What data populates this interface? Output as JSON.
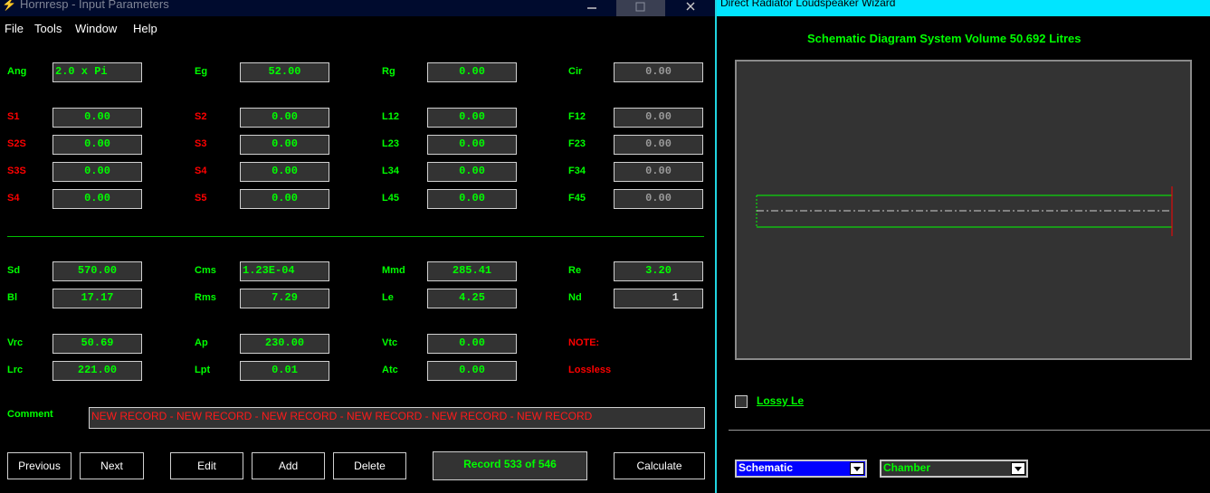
{
  "left_window": {
    "title": "Hornresp - Input Parameters",
    "minimize_icon": "minimize-icon",
    "maximize_icon": "maximize-icon",
    "close_icon": "close-icon",
    "menu": [
      "File",
      "Tools",
      "Window",
      "Help"
    ],
    "rows": [
      [
        {
          "label": "Ang",
          "color": "g",
          "value": "2.0 x Pi",
          "align": "left"
        },
        {
          "label": "Eg",
          "color": "g",
          "value": "52.00"
        },
        {
          "label": "Rg",
          "color": "g",
          "value": "0.00"
        },
        {
          "label": "Cir",
          "color": "g",
          "value": "0.00",
          "dim": true
        }
      ],
      [
        {
          "label": "S1",
          "color": "r",
          "value": "0.00"
        },
        {
          "label": "S2",
          "color": "r",
          "value": "0.00"
        },
        {
          "label": "L12",
          "color": "g",
          "value": "0.00"
        },
        {
          "label": "F12",
          "color": "g",
          "value": "0.00",
          "dim": true
        }
      ],
      [
        {
          "label": "S2S",
          "color": "r",
          "value": "0.00"
        },
        {
          "label": "S3",
          "color": "r",
          "value": "0.00"
        },
        {
          "label": "L23",
          "color": "g",
          "value": "0.00"
        },
        {
          "label": "F23",
          "color": "g",
          "value": "0.00",
          "dim": true
        }
      ],
      [
        {
          "label": "S3S",
          "color": "r",
          "value": "0.00"
        },
        {
          "label": "S4",
          "color": "r",
          "value": "0.00"
        },
        {
          "label": "L34",
          "color": "g",
          "value": "0.00"
        },
        {
          "label": "F34",
          "color": "g",
          "value": "0.00",
          "dim": true
        }
      ],
      [
        {
          "label": "S4",
          "color": "r",
          "value": "0.00"
        },
        {
          "label": "S5",
          "color": "r",
          "value": "0.00"
        },
        {
          "label": "L45",
          "color": "g",
          "value": "0.00"
        },
        {
          "label": "F45",
          "color": "g",
          "value": "0.00",
          "dim": true
        }
      ],
      [
        {
          "label": "Sd",
          "color": "g",
          "value": "570.00"
        },
        {
          "label": "Cms",
          "color": "g",
          "value": "1.23E-04",
          "align": "left"
        },
        {
          "label": "Mmd",
          "color": "g",
          "value": "285.41"
        },
        {
          "label": "Re",
          "color": "g",
          "value": "3.20"
        }
      ],
      [
        {
          "label": "Bl",
          "color": "g",
          "value": "17.17"
        },
        {
          "label": "Rms",
          "color": "g",
          "value": "7.29"
        },
        {
          "label": "Le",
          "color": "g",
          "value": "4.25"
        },
        {
          "label": "Nd",
          "color": "g",
          "value": "1",
          "align": "right"
        }
      ],
      [
        {
          "label": "Vrc",
          "color": "g",
          "value": "50.69"
        },
        {
          "label": "Ap",
          "color": "g",
          "value": "230.00"
        },
        {
          "label": "Vtc",
          "color": "g",
          "value": "0.00"
        },
        {
          "label": "NOTE:",
          "color": "r",
          "value": null
        }
      ],
      [
        {
          "label": "Lrc",
          "color": "g",
          "value": "221.00"
        },
        {
          "label": "Lpt",
          "color": "g",
          "value": "0.01"
        },
        {
          "label": "Atc",
          "color": "g",
          "value": "0.00"
        },
        {
          "label": "Lossless",
          "color": "r",
          "value": null
        }
      ]
    ],
    "comment_label": "Comment",
    "comment_value": "NEW RECORD - NEW RECORD - NEW RECORD - NEW RECORD - NEW RECORD - NEW RECORD",
    "buttons": {
      "previous": "Previous",
      "next": "Next",
      "edit": "Edit",
      "add": "Add",
      "delete": "Delete",
      "calculate": "Calculate"
    },
    "record_status": "Record 533 of 546"
  },
  "right_window": {
    "title": "Direct Radiator Loudspeaker Wizard",
    "schematic_title": "Schematic Diagram   System Volume 50.692 Litres",
    "lossy_le_label": "Lossy Le",
    "lossy_le_checked": false,
    "dropdown_view": "Schematic",
    "dropdown_chamber": "Chamber"
  },
  "colors": {
    "green": "#00ff00",
    "red": "#ff0000",
    "panel": "#333333",
    "cyan": "#00e5ff"
  }
}
